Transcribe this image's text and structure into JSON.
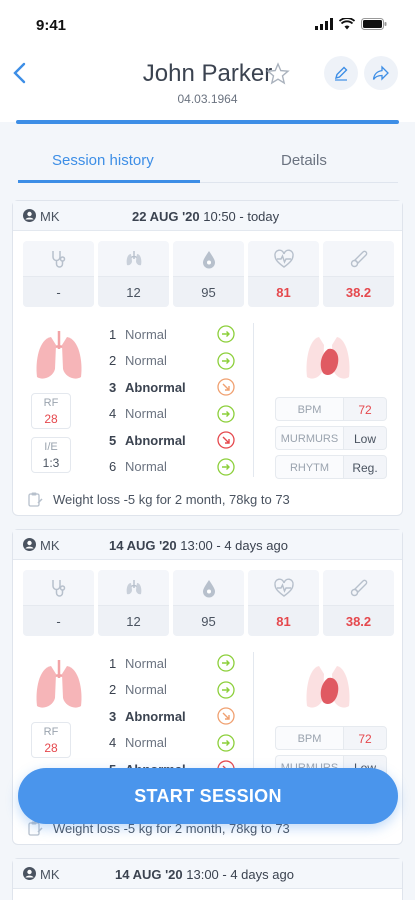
{
  "status": {
    "time": "9:41"
  },
  "header": {
    "patient_name": "John Parker",
    "birth_date": "04.03.1964"
  },
  "tabs": {
    "active": "Session history",
    "inactive": "Details"
  },
  "sessions": [
    {
      "initials": "MK",
      "date": "22 AUG '20",
      "when": " 10:50 - today",
      "vitals": [
        "-",
        "12",
        "95",
        "81",
        "38.2"
      ],
      "rf_label": "RF",
      "rf_value": "28",
      "ie_label": "I/E",
      "ie_value": "1:3",
      "zones": [
        {
          "n": "1",
          "t": "Normal"
        },
        {
          "n": "2",
          "t": "Normal"
        },
        {
          "n": "3",
          "t": "Abnormal"
        },
        {
          "n": "4",
          "t": "Normal"
        },
        {
          "n": "5",
          "t": "Abnormal"
        },
        {
          "n": "6",
          "t": "Normal"
        }
      ],
      "bpm_label": "BPM",
      "bpm": "72",
      "murmurs_label": "MURMURS",
      "murmurs": "Low",
      "rhythm_label": "RHYTM",
      "rhythm": "Reg.",
      "note": "Weight loss -5 kg for 2 month, 78kg to 73"
    },
    {
      "initials": "MK",
      "date": "14 AUG '20",
      "when": " 13:00 - 4 days ago",
      "vitals": [
        "-",
        "12",
        "95",
        "81",
        "38.2"
      ],
      "rf_label": "RF",
      "rf_value": "28",
      "zones": [
        {
          "n": "1",
          "t": "Normal"
        },
        {
          "n": "2",
          "t": "Normal"
        },
        {
          "n": "3",
          "t": "Abnormal"
        },
        {
          "n": "4",
          "t": "Normal"
        },
        {
          "n": "5",
          "t": "Abnormal"
        }
      ],
      "bpm_label": "BPM",
      "bpm": "72",
      "murmurs_label": "MURMURS",
      "murmurs": "Low",
      "note": "Weight loss -5 kg for 2 month, 78kg to 73"
    },
    {
      "initials": "MK",
      "date": "14 AUG '20",
      "when": " 13:00 - 4 days ago"
    }
  ],
  "start_button": "START SESSION",
  "colors": {
    "accent": "#3d8ee6",
    "alert": "#e5484d",
    "ok": "#8ccf3a",
    "warn": "#f0a070"
  }
}
